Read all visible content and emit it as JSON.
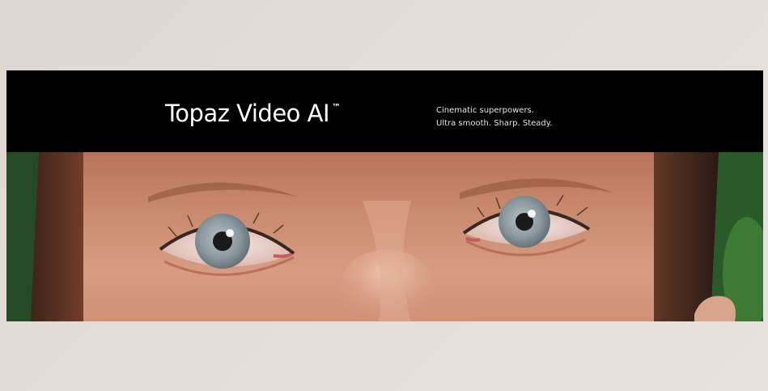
{
  "banner": {
    "brand_name": "Topaz Video AI",
    "trademark": "™",
    "tagline_line1": "Cinematic superpowers.",
    "tagline_line2": "Ultra smooth. Sharp. Steady."
  },
  "image": {
    "subject": "close-up of eyes",
    "icon": "face-photo",
    "colors": {
      "background": "#e4ddd8",
      "banner": "#000000",
      "skin": "#c98a6c",
      "iris": "#8d9aa2",
      "foliage": "#2e5a2c"
    }
  }
}
